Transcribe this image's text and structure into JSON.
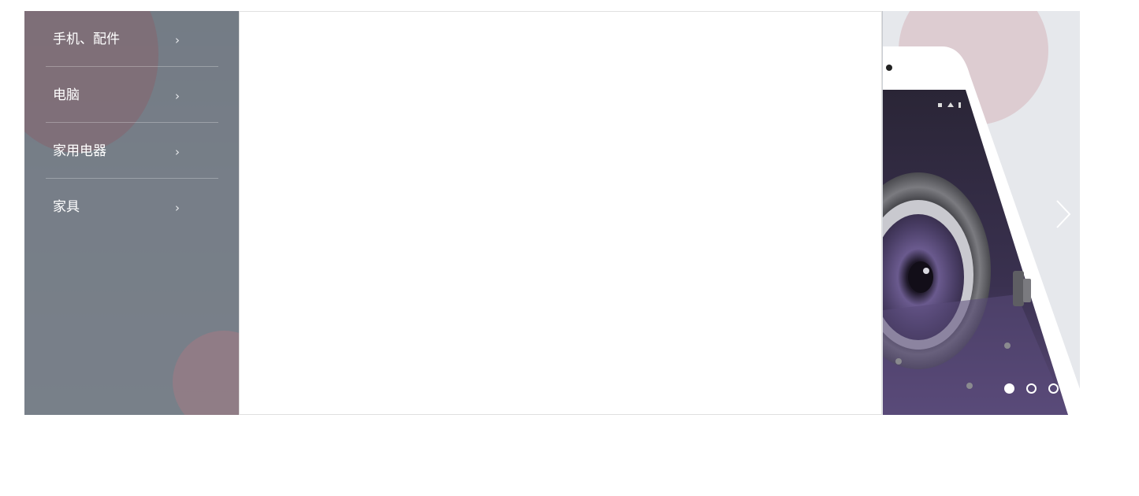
{
  "categories": [
    {
      "label": "手机、配件",
      "arrow": "›"
    },
    {
      "label": "电脑",
      "arrow": "›"
    },
    {
      "label": "家用电器",
      "arrow": "›"
    },
    {
      "label": "家具",
      "arrow": "›"
    }
  ],
  "carousel": {
    "slide_count": 3,
    "active_index": 0,
    "next_icon": "chevron-right-icon"
  },
  "colors": {
    "menu_bg": "#69717b",
    "phone_screen": "#2b2538",
    "accent_pink": "#d6aab2"
  }
}
